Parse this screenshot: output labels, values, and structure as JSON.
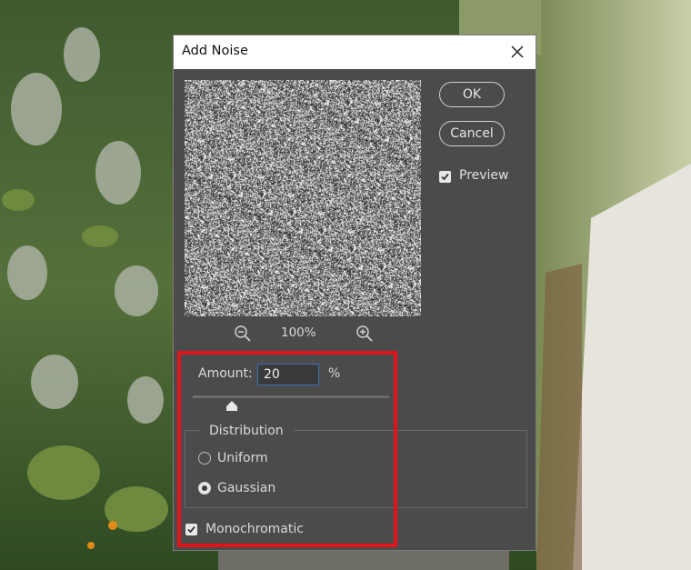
{
  "dialog": {
    "title": "Add Noise",
    "close_icon": "close-icon",
    "ok_label": "OK",
    "cancel_label": "Cancel",
    "preview_label": "Preview",
    "preview_checked": true,
    "zoom_level": "100%",
    "amount_label": "Amount:",
    "amount_value": "20",
    "amount_unit": "%",
    "amount_slider_fraction": 0.2,
    "distribution": {
      "legend": "Distribution",
      "options": [
        "Uniform",
        "Gaussian"
      ],
      "selected": "Gaussian"
    },
    "monochromatic_label": "Monochromatic",
    "monochromatic_checked": true
  },
  "colors": {
    "dialog_bg": "#4b4b4b",
    "highlight": "#e0141a",
    "input_border": "#3f6fb5"
  }
}
